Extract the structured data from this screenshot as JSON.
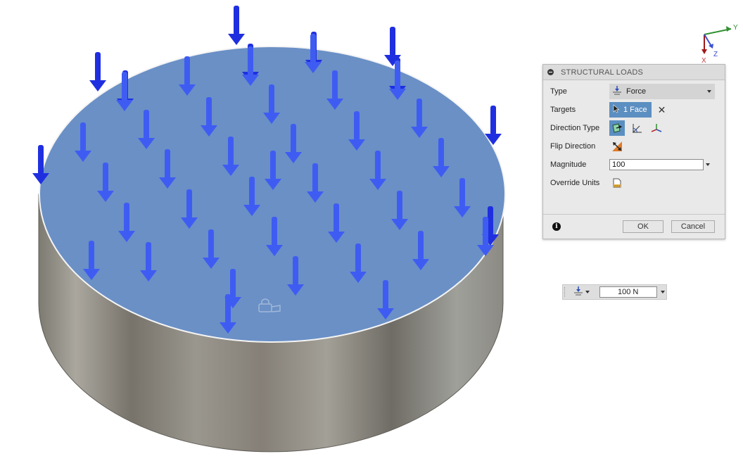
{
  "dialog": {
    "title": "STRUCTURAL LOADS",
    "rows": {
      "type": {
        "label": "Type",
        "value": "Force"
      },
      "targets": {
        "label": "Targets",
        "value": "1 Face"
      },
      "direction_type": {
        "label": "Direction Type"
      },
      "flip_direction": {
        "label": "Flip Direction"
      },
      "magnitude": {
        "label": "Magnitude",
        "value": "100"
      },
      "override_units": {
        "label": "Override Units"
      }
    },
    "ok_label": "OK",
    "cancel_label": "Cancel"
  },
  "manipulator": {
    "value": "100 N"
  },
  "view_cube": {
    "x_label": "X",
    "y_label": "Y",
    "z_label": "Z"
  },
  "colors": {
    "load_arrow": "#1f2fe0",
    "load_arrow_on_face": "#3f5cf2",
    "selected_face": "#6a90c6",
    "cylinder_side": "#8a8780",
    "active_button": "#5b8fc1",
    "dialog_bg": "#e9e9e9"
  },
  "icons": [
    "force-type-icon",
    "select-cursor-icon",
    "clear-selection-icon",
    "normal-direction-icon",
    "angle-direction-icon",
    "xyz-vectors-icon",
    "flip-direction-icon",
    "override-units-icon",
    "info-icon"
  ]
}
